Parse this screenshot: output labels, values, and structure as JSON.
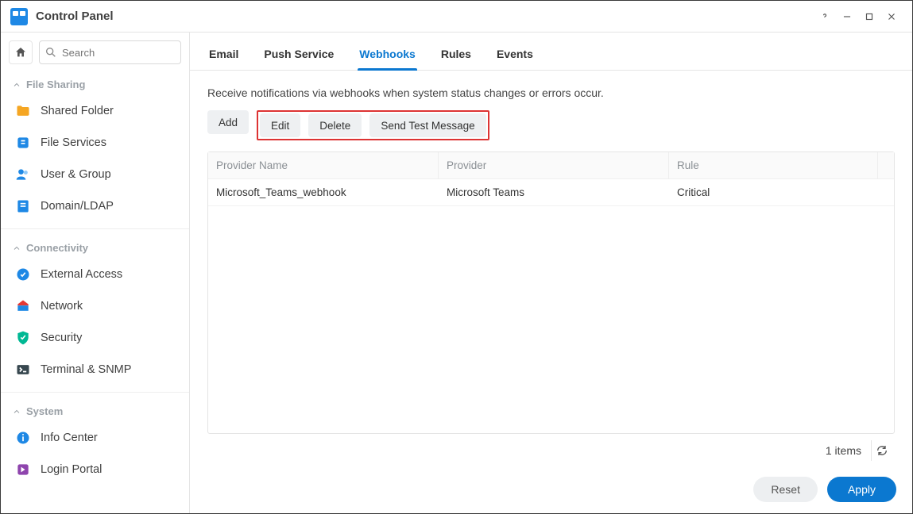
{
  "window": {
    "title": "Control Panel"
  },
  "search": {
    "placeholder": "Search"
  },
  "sections": {
    "file_sharing": {
      "label": "File Sharing",
      "items": [
        {
          "label": "Shared Folder"
        },
        {
          "label": "File Services"
        },
        {
          "label": "User & Group"
        },
        {
          "label": "Domain/LDAP"
        }
      ]
    },
    "connectivity": {
      "label": "Connectivity",
      "items": [
        {
          "label": "External Access"
        },
        {
          "label": "Network"
        },
        {
          "label": "Security"
        },
        {
          "label": "Terminal & SNMP"
        }
      ]
    },
    "system": {
      "label": "System",
      "items": [
        {
          "label": "Info Center"
        },
        {
          "label": "Login Portal"
        }
      ]
    }
  },
  "tabs": [
    {
      "key": "email",
      "label": "Email"
    },
    {
      "key": "push",
      "label": "Push Service"
    },
    {
      "key": "webhooks",
      "label": "Webhooks",
      "active": true
    },
    {
      "key": "rules",
      "label": "Rules"
    },
    {
      "key": "events",
      "label": "Events"
    }
  ],
  "description": "Receive notifications via webhooks when system status changes or errors occur.",
  "toolbar": {
    "add": "Add",
    "edit": "Edit",
    "delete": "Delete",
    "send_test": "Send Test Message"
  },
  "table": {
    "headers": {
      "provider_name": "Provider Name",
      "provider": "Provider",
      "rule": "Rule"
    },
    "rows": [
      {
        "provider_name": "Microsoft_Teams_webhook",
        "provider": "Microsoft Teams",
        "rule": "Critical"
      }
    ]
  },
  "status": {
    "item_count": "1 items"
  },
  "footer": {
    "reset": "Reset",
    "apply": "Apply"
  }
}
